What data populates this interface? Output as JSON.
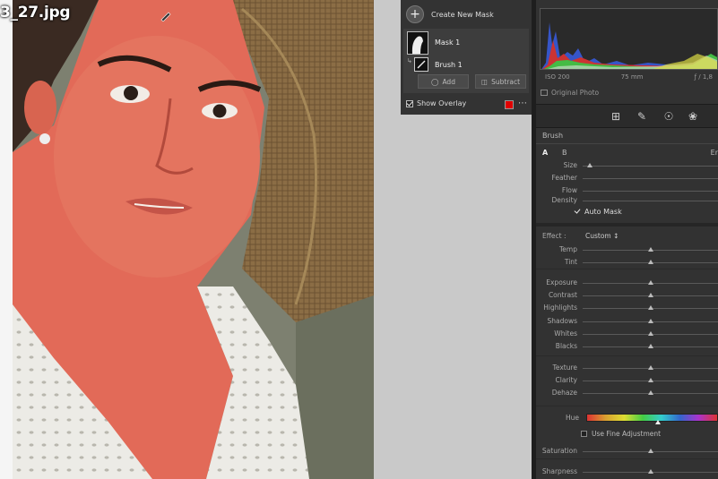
{
  "photo": {
    "file_name": "3_27.jpg"
  },
  "mask_panel": {
    "create_label": "Create New Mask",
    "mask_name": "Mask 1",
    "brush_name": "Brush 1",
    "add_label": "Add",
    "subtract_label": "Subtract",
    "show_overlay_label": "Show Overlay",
    "show_overlay_checked": true,
    "overlay_color": "#e00000"
  },
  "histogram": {
    "iso": "ISO 200",
    "focal": "75 mm",
    "aperture": "ƒ / 1,8",
    "original_photo_label": "Original Photo"
  },
  "tools": [
    "crop-icon",
    "heal-icon",
    "red-eye-icon",
    "masking-icon"
  ],
  "brush": {
    "title": "Brush",
    "tab_a": "A",
    "tab_b": "B",
    "tab_erase": "Er",
    "settings": [
      {
        "label": "Size",
        "value": 0.05
      },
      {
        "label": "Feather",
        "value": null
      },
      {
        "label": "Flow",
        "value": null
      },
      {
        "label": "Density",
        "value": null
      }
    ],
    "auto_mask_label": "Auto Mask",
    "auto_mask_checked": true
  },
  "effect": {
    "label": "Effect :",
    "preset": "Custom ↕"
  },
  "sliders": {
    "temp_tint": [
      {
        "label": "Temp",
        "value": 0.5
      },
      {
        "label": "Tint",
        "value": 0.5
      }
    ],
    "tone": [
      {
        "label": "Exposure",
        "value": 0.5
      },
      {
        "label": "Contrast",
        "value": 0.5
      },
      {
        "label": "Highlights",
        "value": 0.5
      },
      {
        "label": "Shadows",
        "value": 0.5
      },
      {
        "label": "Whites",
        "value": 0.5
      },
      {
        "label": "Blacks",
        "value": 0.5
      }
    ],
    "presence": [
      {
        "label": "Texture",
        "value": 0.5
      },
      {
        "label": "Clarity",
        "value": 0.5
      },
      {
        "label": "Dehaze",
        "value": 0.5
      }
    ],
    "hue_label": "Hue",
    "fine_adjustment_label": "Use Fine Adjustment",
    "color": [
      {
        "label": "Saturation",
        "value": 0.5
      }
    ],
    "detail": [
      {
        "label": "Sharpness",
        "value": 0.5
      }
    ]
  }
}
